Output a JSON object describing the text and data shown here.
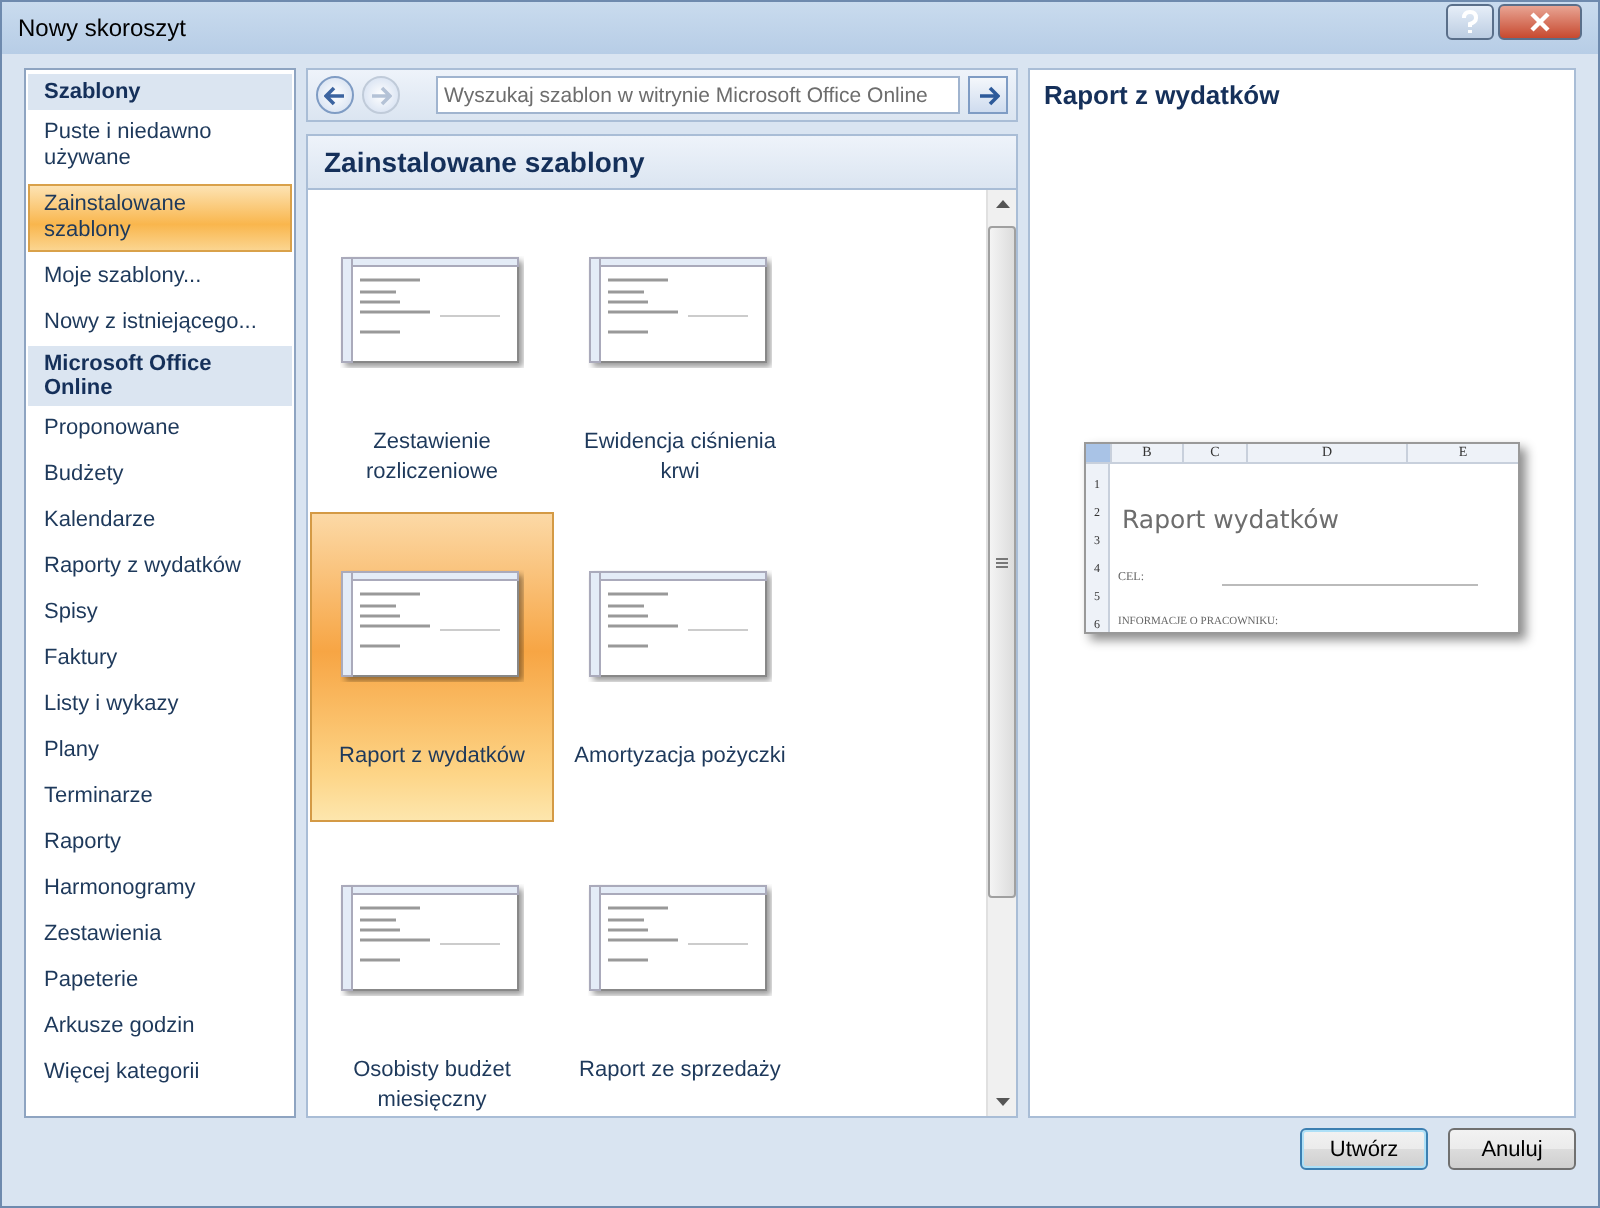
{
  "window": {
    "title": "Nowy skoroszyt"
  },
  "sidebar": {
    "items": [
      {
        "kind": "header",
        "label": "Szablony"
      },
      {
        "kind": "item",
        "label": "Puste i niedawno używane",
        "selected": false
      },
      {
        "kind": "item",
        "label": "Zainstalowane szablony",
        "selected": true
      },
      {
        "kind": "item",
        "label": "Moje szablony...",
        "selected": false
      },
      {
        "kind": "item",
        "label": "Nowy z istniejącego...",
        "selected": false
      },
      {
        "kind": "header",
        "label": "Microsoft Office Online"
      },
      {
        "kind": "item",
        "label": "Proponowane",
        "selected": false
      },
      {
        "kind": "item",
        "label": "Budżety",
        "selected": false
      },
      {
        "kind": "item",
        "label": "Kalendarze",
        "selected": false
      },
      {
        "kind": "item",
        "label": "Raporty z wydatków",
        "selected": false
      },
      {
        "kind": "item",
        "label": "Spisy",
        "selected": false
      },
      {
        "kind": "item",
        "label": "Faktury",
        "selected": false
      },
      {
        "kind": "item",
        "label": "Listy i wykazy",
        "selected": false
      },
      {
        "kind": "item",
        "label": "Plany",
        "selected": false
      },
      {
        "kind": "item",
        "label": "Terminarze",
        "selected": false
      },
      {
        "kind": "item",
        "label": "Raporty",
        "selected": false
      },
      {
        "kind": "item",
        "label": "Harmonogramy",
        "selected": false
      },
      {
        "kind": "item",
        "label": "Zestawienia",
        "selected": false
      },
      {
        "kind": "item",
        "label": "Papeterie",
        "selected": false
      },
      {
        "kind": "item",
        "label": "Arkusze godzin",
        "selected": false
      },
      {
        "kind": "item",
        "label": "Więcej kategorii",
        "selected": false
      }
    ]
  },
  "search": {
    "placeholder": "Wyszukaj szablon w witrynie Microsoft Office Online"
  },
  "gallery": {
    "title": "Zainstalowane szablony",
    "templates": [
      {
        "label": "Zestawienie rozliczeniowe",
        "selected": false
      },
      {
        "label": "Ewidencja ciśnienia krwi",
        "selected": false
      },
      {
        "label": "Raport z wydatków",
        "selected": true
      },
      {
        "label": "Amortyzacja pożyczki",
        "selected": false
      },
      {
        "label": "Osobisty budżet miesięczny",
        "selected": false
      },
      {
        "label": "Raport ze sprzedaży",
        "selected": false
      }
    ]
  },
  "preview": {
    "title": "Raport z wydatków",
    "sheet": {
      "columns": [
        "B",
        "C",
        "D",
        "E"
      ],
      "rows": [
        "1",
        "2",
        "3",
        "4",
        "5",
        "6"
      ],
      "heading": "Raport wydatków",
      "field_label": "CEL:",
      "section_label": "INFORMACJE O PRACOWNIKU:"
    }
  },
  "buttons": [
    {
      "label": "Utwórz",
      "kind": "default"
    },
    {
      "label": "Anuluj",
      "kind": "normal"
    }
  ]
}
